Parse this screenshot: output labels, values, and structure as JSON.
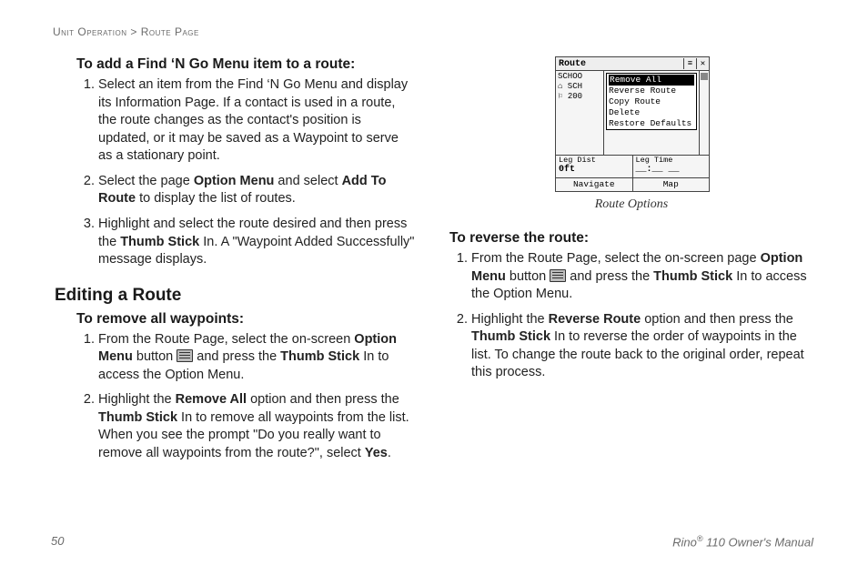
{
  "breadcrumb": {
    "a": "Unit Operation",
    "sep": " > ",
    "b": "Route Page"
  },
  "left": {
    "h1": "To add a Find ‘N Go Menu item to a route:",
    "s1": [
      "Select an item from the Find ‘N Go Menu and display its Information Page. If a contact is used in a route, the route changes as the contact's position is updated, or it may be saved as a Waypoint to serve as a stationary point.",
      {
        "pre": "Select the page ",
        "b1": "Option Menu",
        "mid": " and select ",
        "b2": "Add To Route",
        "post": " to display the list of routes."
      },
      {
        "pre": "Highlight and select the route desired and then press the ",
        "b1": "Thumb Stick",
        "post": " In. A \"Waypoint Added Successfully\" message displays."
      }
    ],
    "section": "Editing a Route",
    "h2": "To remove all waypoints:",
    "s2": [
      {
        "pre": "From the Route Page, select the on-screen ",
        "b1": "Option Menu",
        "mid": " button ",
        "icon": true,
        "mid2": " and press the ",
        "b2": "Thumb Stick",
        "post": " In to access the Option Menu."
      },
      {
        "pre": "Highlight the ",
        "b1": "Remove All",
        "mid": " option and then press the ",
        "b2": "Thumb Stick",
        "mid2": " In to remove all waypoints from the list. When you see the prompt \"Do you really want to remove all waypoints from the route?\", select ",
        "b3": "Yes",
        "post": "."
      }
    ]
  },
  "right": {
    "caption": "Route Options",
    "h1": "To reverse the route:",
    "s1": [
      {
        "pre": "From the Route Page, select the on-screen page ",
        "b1": "Option Menu",
        "mid": " button ",
        "icon": true,
        "mid2": " and press the ",
        "b2": "Thumb Stick",
        "post": " In to access the Option Menu."
      },
      {
        "pre": "Highlight the ",
        "b1": "Reverse Route",
        "mid": " option and then press the ",
        "b2": "Thumb Stick",
        "post": " In to reverse the order of waypoints in the list. To change the route back to the original order, repeat this process."
      }
    ]
  },
  "shot": {
    "title": "Route",
    "leftRows": [
      "SCHOO",
      "⌂ SCH",
      "⚐ 200"
    ],
    "menu": [
      "Remove All",
      "Reverse Route",
      "Copy Route",
      "Delete",
      "Restore Defaults"
    ],
    "stat": [
      {
        "label": "Leg Dist",
        "val": "0ft"
      },
      {
        "label": "Leg Time",
        "val": "__:__ __"
      }
    ],
    "bot": [
      "Navigate",
      "Map"
    ]
  },
  "footer": {
    "page": "50",
    "manual_pre": "Rino",
    "manual_sup": "®",
    "manual_post": " 110 Owner's Manual"
  }
}
